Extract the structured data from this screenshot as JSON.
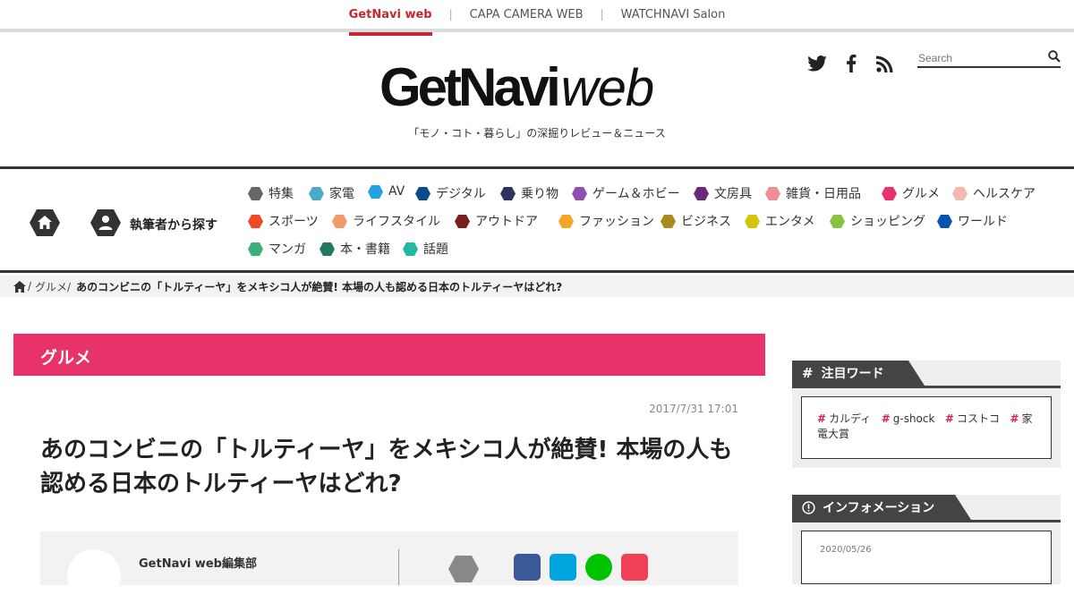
{
  "network": {
    "links": [
      {
        "label": "GetNavi web",
        "active": true
      },
      {
        "label": "CAPA CAMERA WEB",
        "active": false
      },
      {
        "label": "WATCHNAVI Salon",
        "active": false
      }
    ],
    "separator": "|"
  },
  "header": {
    "logo_strong": "GetNavi",
    "logo_light": "web",
    "tagline": "「モノ・コト・暮らし」の深掘りレビュー＆ニュース",
    "search_placeholder": "Search",
    "social_icons": [
      "twitter-icon",
      "facebook-icon",
      "rss-icon"
    ]
  },
  "nav": {
    "author_label": "執筆者から探す",
    "categories": [
      {
        "label": "特集",
        "color": "#666666"
      },
      {
        "label": "家電",
        "color": "#4aacc9"
      },
      {
        "label": "AV",
        "color": "#20a3e0"
      },
      {
        "label": "デジタル",
        "color": "#0a4a85"
      },
      {
        "label": "乗り物",
        "color": "#2c3560"
      },
      {
        "label": "ゲーム＆ホビー",
        "color": "#8e4fb0"
      },
      {
        "label": "文房具",
        "color": "#6a2a7a"
      },
      {
        "label": "雑貨・日用品",
        "color": "#ef8d95"
      },
      {
        "label": "グルメ",
        "color": "#e8336a"
      },
      {
        "label": "ヘルスケア",
        "color": "#f5b8ad"
      },
      {
        "label": "スポーツ",
        "color": "#f04a24"
      },
      {
        "label": "ライフスタイル",
        "color": "#f29a68"
      },
      {
        "label": "アウトドア",
        "color": "#7a1f1f"
      },
      {
        "label": "ファッション",
        "color": "#f5a623"
      },
      {
        "label": "ビジネス",
        "color": "#a88a1e"
      },
      {
        "label": "エンタメ",
        "color": "#d4c40c"
      },
      {
        "label": "ショッピング",
        "color": "#86c440"
      },
      {
        "label": "ワールド",
        "color": "#0a52b0"
      },
      {
        "label": "マンガ",
        "color": "#3bb07a"
      },
      {
        "label": "本・書籍",
        "color": "#1e7a60"
      },
      {
        "label": "話題",
        "color": "#1fbaa0"
      }
    ]
  },
  "breadcrumb": {
    "items": [
      "/",
      "グルメ/"
    ],
    "current": "あのコンビニの「トルティーヤ」をメキシコ人が絶賛! 本場の人も認める日本のトルティーヤはどれ?"
  },
  "article": {
    "category": "グルメ",
    "category_color": "#e8336a",
    "date": "2017/7/31 17:01",
    "title": "あのコンビニの「トルティーヤ」をメキシコ人が絶賛! 本場の人も認める日本のトルティーヤはどれ?",
    "author": "GetNavi web編集部",
    "share_icons": [
      "facebook-share-icon",
      "hatena-share-icon",
      "line-share-icon",
      "pocket-share-icon"
    ]
  },
  "sidebar": {
    "keywords_title": "注目ワード",
    "keywords": [
      "カルディ",
      "g-shock",
      "コストコ",
      "家電大賞"
    ],
    "info_title": "インフォメーション",
    "info_date": "2020/05/26"
  }
}
